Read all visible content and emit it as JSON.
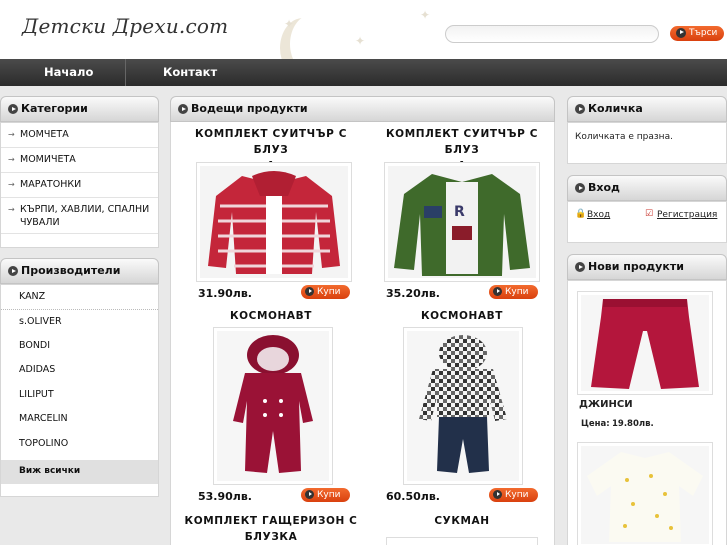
{
  "header": {
    "logo": "Детски Дрехи.com",
    "search_placeholder": "",
    "search_button": "Търси"
  },
  "nav": {
    "items": [
      "Начало",
      "Контакт"
    ]
  },
  "categories": {
    "title": "Категории",
    "items": [
      "МОМЧЕТА",
      "МОМИЧЕТА",
      "МАРАТОНКИ",
      "КЪРПИ, ХАВЛИИ, СПАЛНИ ЧУВАЛИ"
    ]
  },
  "manufacturers": {
    "title": "Производители",
    "items": [
      "KANZ",
      "s.OLIVER",
      "BONDI",
      "ADIDAS",
      "LILIPUT",
      "MARCELIN",
      "TOPOLINO"
    ],
    "view_all": "Виж всички"
  },
  "featured": {
    "title": "Водещи продукти",
    "buy_label": "Купи",
    "products": [
      {
        "title_line1": "КОМПЛЕКТ СУИТЧЪР С БЛУЗ",
        "title_line2": "А",
        "price": "31.90лв."
      },
      {
        "title_line1": "КОМПЛЕКТ СУИТЧЪР С БЛУЗ",
        "title_line2": "А",
        "price": "35.20лв."
      },
      {
        "title_line1": "КОСМОНАВТ",
        "title_line2": "",
        "price": "53.90лв."
      },
      {
        "title_line1": "КОСМОНАВТ",
        "title_line2": "",
        "price": "60.50лв."
      },
      {
        "title_line1": "КОМПЛЕКТ ГАЩЕРИЗОН С",
        "title_line2": "БЛУЗКА",
        "price": ""
      },
      {
        "title_line1": "СУКМАН",
        "title_line2": "",
        "price": ""
      }
    ]
  },
  "cart": {
    "title": "Количка",
    "empty_text": "Количката е празна."
  },
  "login": {
    "title": "Вход",
    "login_link": "Вход",
    "register_link": "Регистрация"
  },
  "new_products": {
    "title": "Нови продукти",
    "item_name": "ДЖИНСИ",
    "price_label": "Цена:",
    "price_value": "19.80лв."
  },
  "colors": {
    "accent": "#e0521f",
    "nav_bg": "#333333"
  }
}
